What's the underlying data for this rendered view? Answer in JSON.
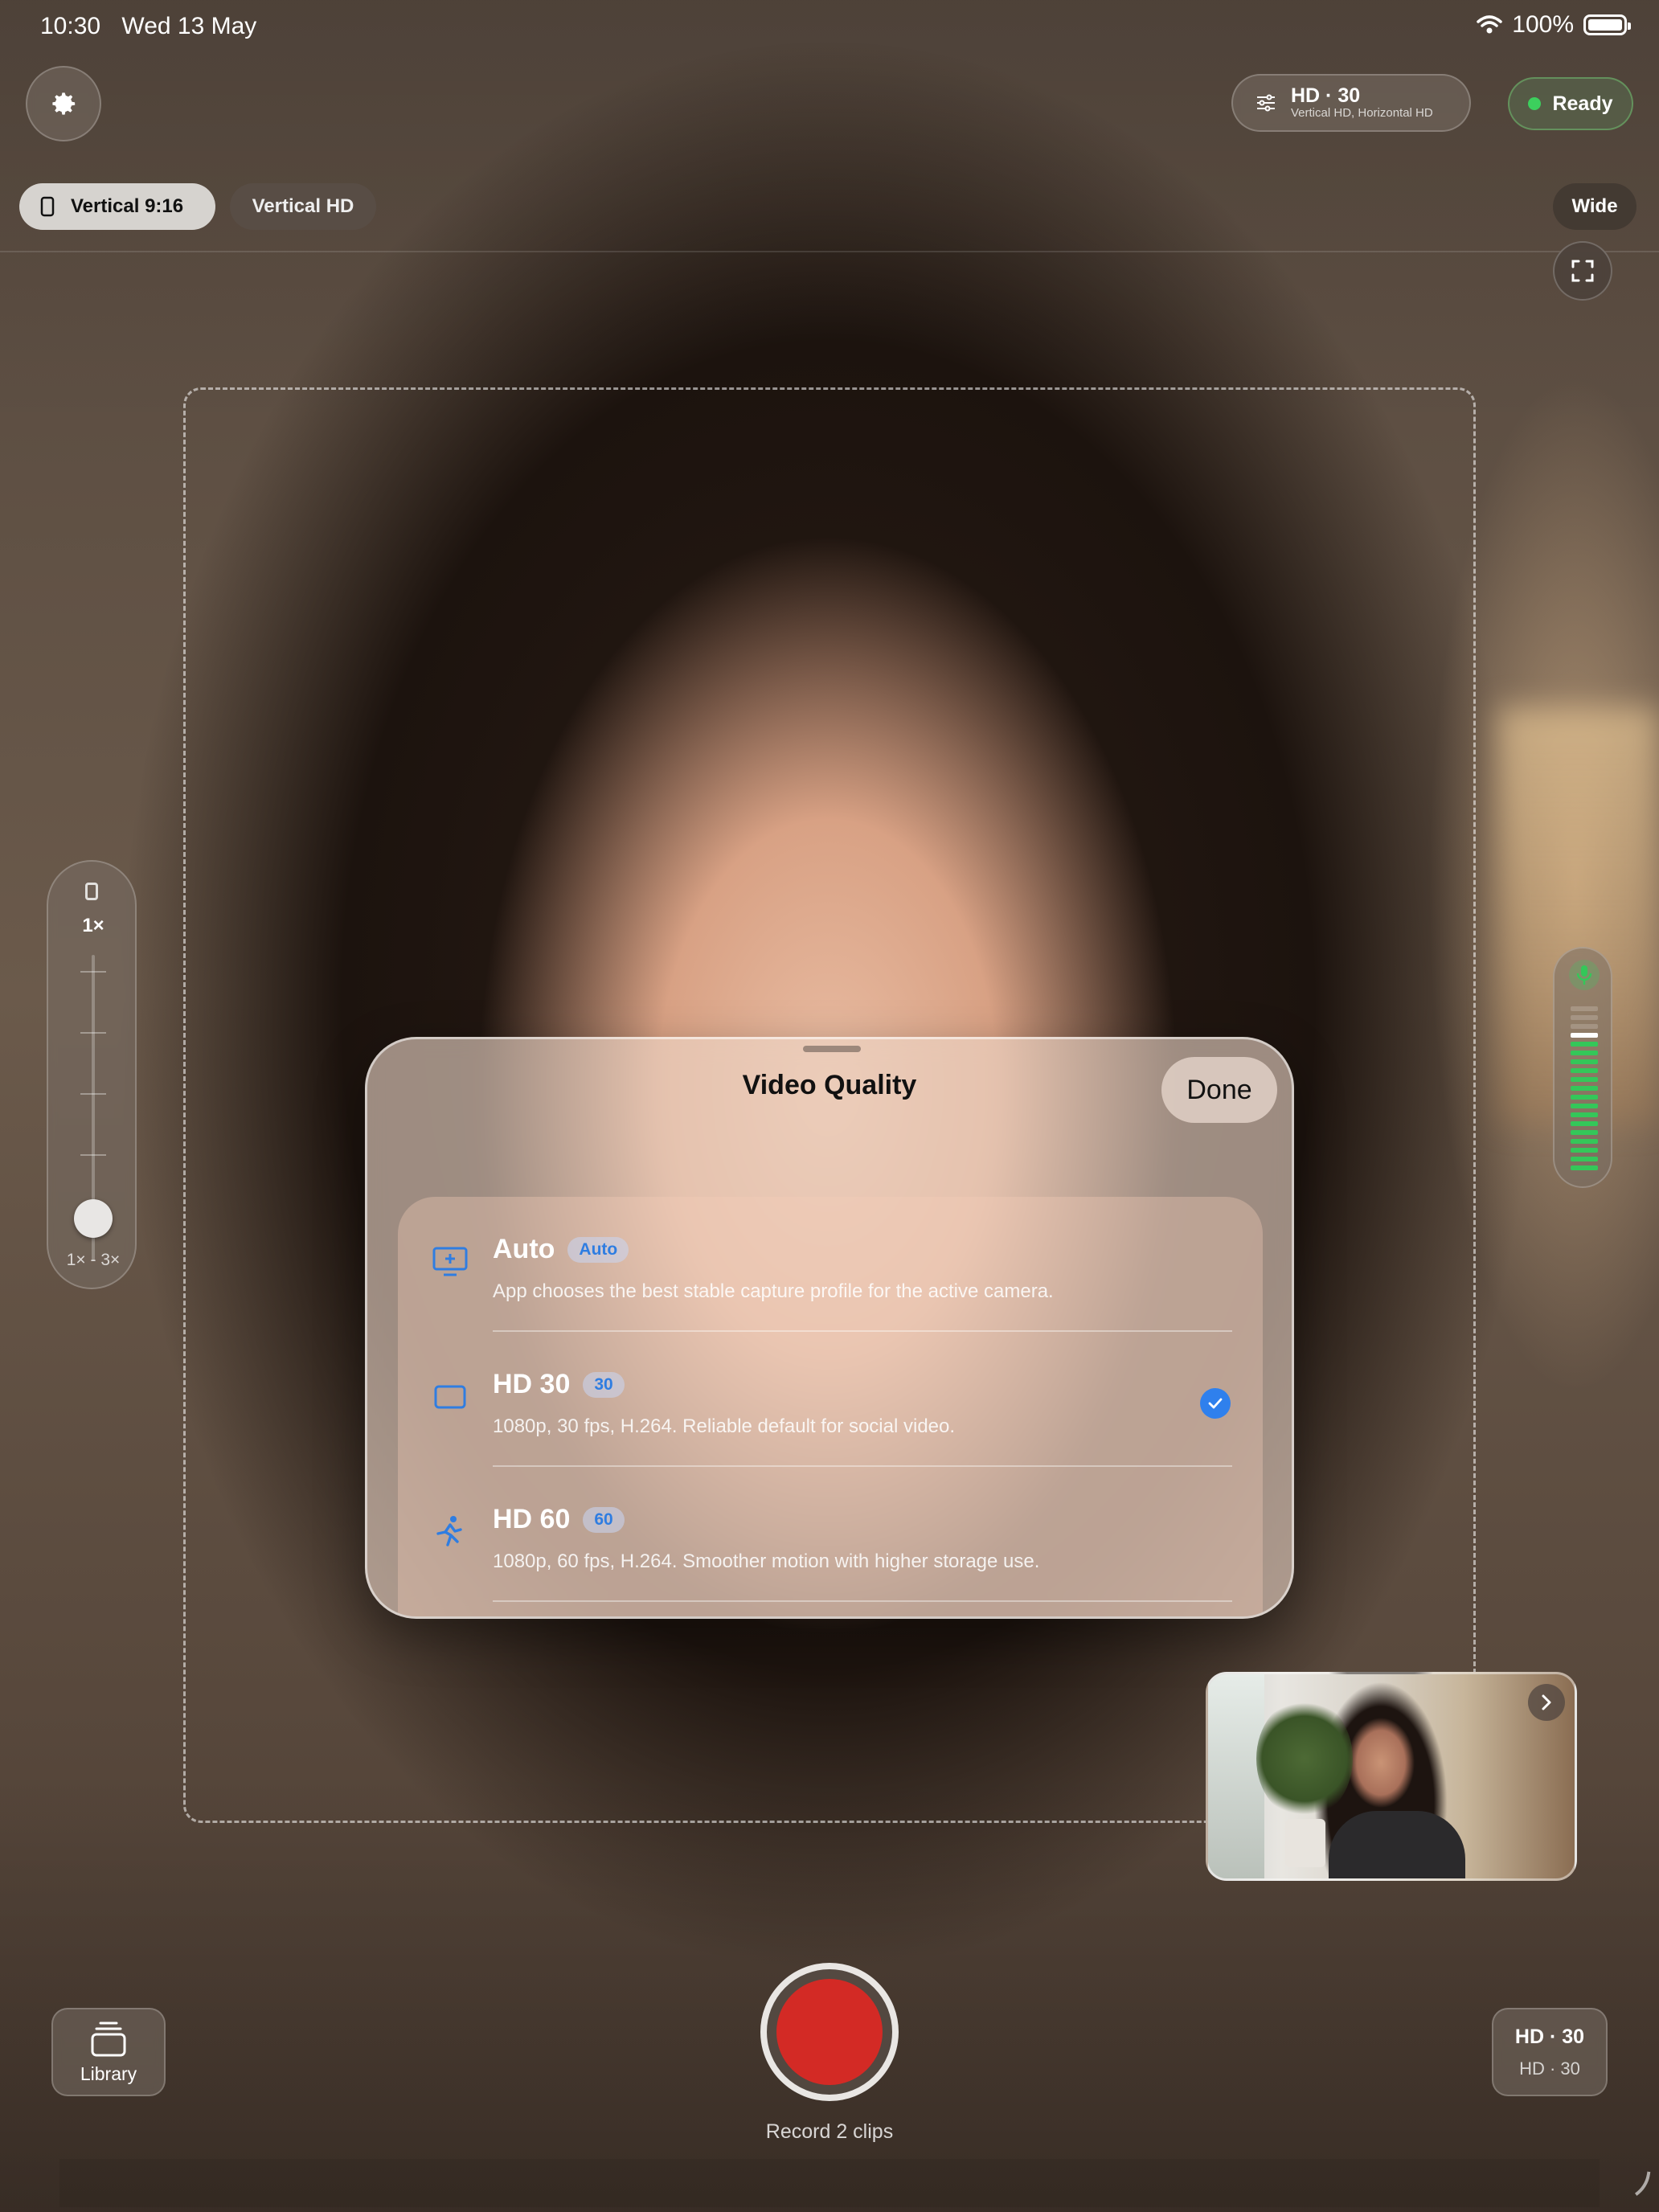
{
  "status_bar": {
    "time": "10:30",
    "date": "Wed 13 May",
    "battery": "100%"
  },
  "top_bar": {
    "quality_pill": {
      "title": "HD · 30",
      "subtitle": "Vertical HD, Horizontal HD"
    },
    "ready_label": "Ready"
  },
  "format_chips": {
    "vertical": "Vertical 9:16",
    "vertical_hd": "Vertical HD",
    "wide": "Wide"
  },
  "zoom": {
    "value": "1×",
    "range": "1× - 3×",
    "level_fraction": 0
  },
  "mic_meter": {
    "level_fraction": 0.8,
    "active_color": "#34c759"
  },
  "sheet": {
    "title": "Video Quality",
    "done_label": "Done",
    "options": [
      {
        "icon": "display-auto-icon",
        "name": "Auto",
        "badge": "Auto",
        "description": "App chooses the best stable capture profile for the active camera.",
        "selected": false
      },
      {
        "icon": "rectangle-icon",
        "name": "HD 30",
        "badge": "30",
        "description": "1080p, 30 fps, H.264. Reliable default for social video.",
        "selected": true
      },
      {
        "icon": "running-figure-icon",
        "name": "HD 60",
        "badge": "60",
        "description": "1080p, 60 fps, H.264. Smoother motion with higher storage use.",
        "selected": false
      }
    ]
  },
  "bottom": {
    "library_label": "Library",
    "record_label": "Record 2 clips",
    "record_color": "#d32a25",
    "quality_button": {
      "title": "HD · 30",
      "subtitle": "HD · 30"
    }
  },
  "colors": {
    "accent": "#2f80ed",
    "ready_green": "#3ccf5d"
  }
}
